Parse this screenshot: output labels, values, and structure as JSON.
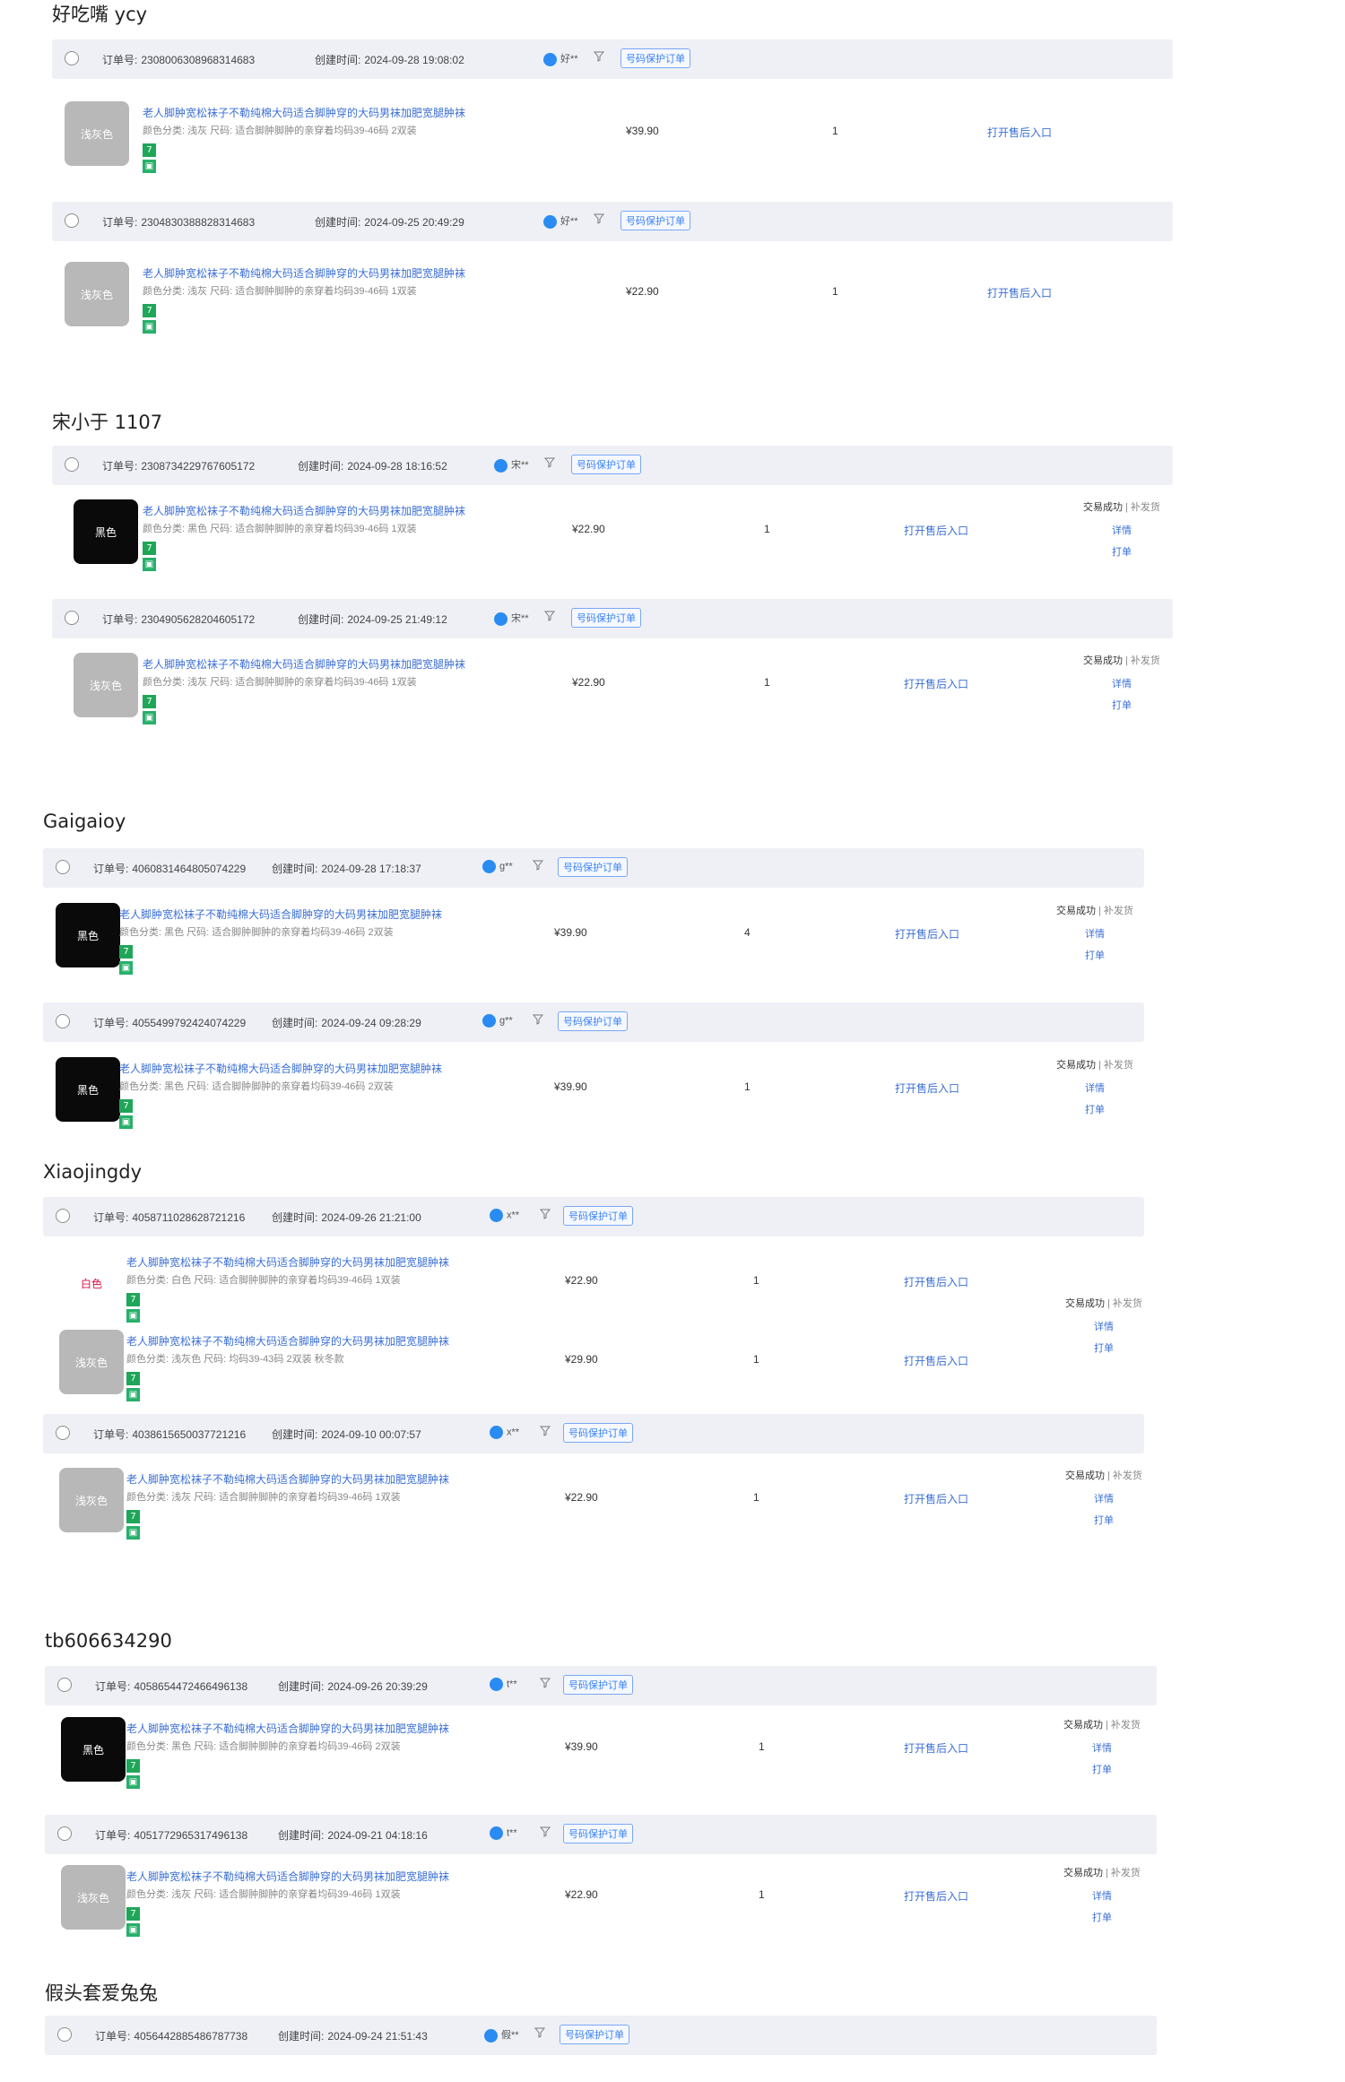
{
  "labels": {
    "order_no": "订单号:",
    "created": "创建时间:",
    "protect_tag": "号码保护订单",
    "after_sale": "打开售后入口",
    "status_ok": "交易成功",
    "detail": "详情",
    "print": "打单",
    "extra_sep": "| 补发货"
  },
  "product_title": "老人脚肿宽松袜子不勒纯棉大码适合脚肿穿的大码男袜加肥宽腿肿袜",
  "sections": [
    {
      "shop": "好吃嘴 ycy",
      "orders": [
        {
          "order_no": "2308006308968314683",
          "created": "2024-09-28 19:08:02",
          "buyer": "好**",
          "items": [
            {
              "thumb": "浅灰色",
              "spec": "颜色分类: 浅灰  尺码: 适合脚肿脚肿的亲穿着均码39-46码 2双装",
              "price": "¥39.90",
              "qty": "1"
            }
          ]
        },
        {
          "order_no": "2304830388828314683",
          "created": "2024-09-25 20:49:29",
          "buyer": "好**",
          "items": [
            {
              "thumb": "浅灰色",
              "spec": "颜色分类: 浅灰  尺码: 适合脚肿脚肿的亲穿着均码39-46码 1双装",
              "price": "¥22.90",
              "qty": "1"
            }
          ]
        }
      ]
    },
    {
      "shop": "宋小于 1107",
      "orders": [
        {
          "order_no": "2308734229767605172",
          "created": "2024-09-28 18:16:52",
          "buyer": "宋**",
          "items": [
            {
              "thumb": "黑色",
              "spec": "颜色分类: 黑色  尺码: 适合脚肿脚肿的亲穿着均码39-46码 1双装",
              "price": "¥22.90",
              "qty": "1"
            }
          ]
        },
        {
          "order_no": "2304905628204605172",
          "created": "2024-09-25 21:49:12",
          "buyer": "宋**",
          "items": [
            {
              "thumb": "浅灰色",
              "spec": "颜色分类: 浅灰  尺码: 适合脚肿脚肿的亲穿着均码39-46码 1双装",
              "price": "¥22.90",
              "qty": "1"
            }
          ]
        }
      ]
    },
    {
      "shop": "Gaigaioy",
      "orders": [
        {
          "order_no": "4060831464805074229",
          "created": "2024-09-28 17:18:37",
          "buyer": "g**",
          "items": [
            {
              "thumb": "黑色",
              "spec": "颜色分类: 黑色  尺码: 适合脚肿脚肿的亲穿着均码39-46码 2双装",
              "price": "¥39.90",
              "qty": "4"
            }
          ]
        },
        {
          "order_no": "4055499792424074229",
          "created": "2024-09-24 09:28:29",
          "buyer": "g**",
          "items": [
            {
              "thumb": "黑色",
              "spec": "颜色分类: 黑色  尺码: 适合脚肿脚肿的亲穿着均码39-46码 2双装",
              "price": "¥39.90",
              "qty": "1"
            }
          ]
        }
      ]
    },
    {
      "shop": "Xiaojingdy",
      "orders": [
        {
          "order_no": "4058711028628721216",
          "created": "2024-09-26 21:21:00",
          "buyer": "x**",
          "items": [
            {
              "thumb": "白色",
              "spec": "颜色分类: 白色  尺码: 适合脚肿脚肿的亲穿着均码39-46码 1双装",
              "price": "¥22.90",
              "qty": "1"
            },
            {
              "thumb": "浅灰色",
              "spec": "颜色分类: 浅灰色  尺码: 均码39-43码 2双装 秋冬款",
              "price": "¥29.90",
              "qty": "1"
            }
          ]
        },
        {
          "order_no": "4038615650037721216",
          "created": "2024-09-10 00:07:57",
          "buyer": "x**",
          "items": [
            {
              "thumb": "浅灰色",
              "spec": "颜色分类: 浅灰  尺码: 适合脚肿脚肿的亲穿着均码39-46码 1双装",
              "price": "¥22.90",
              "qty": "1"
            }
          ]
        }
      ]
    },
    {
      "shop": "tb606634290",
      "orders": [
        {
          "order_no": "4058654472466496138",
          "created": "2024-09-26 20:39:29",
          "buyer": "t**",
          "items": [
            {
              "thumb": "黑色",
              "spec": "颜色分类: 黑色  尺码: 适合脚肿脚肿的亲穿着均码39-46码 2双装",
              "price": "¥39.90",
              "qty": "1"
            }
          ]
        },
        {
          "order_no": "4051772965317496138",
          "created": "2024-09-21 04:18:16",
          "buyer": "t**",
          "items": [
            {
              "thumb": "浅灰色",
              "spec": "颜色分类: 浅灰  尺码: 适合脚肿脚肿的亲穿着均码39-46码 1双装",
              "price": "¥22.90",
              "qty": "1"
            }
          ]
        }
      ]
    },
    {
      "shop": "假头套爱兔兔",
      "orders": [
        {
          "order_no": "4056442885486787738",
          "created": "2024-09-24 21:51:43",
          "buyer": "假**",
          "items": []
        }
      ]
    }
  ],
  "colors": {
    "header_bg": "#eef0f6",
    "link": "#3b6fd4",
    "badge_green": "#1fa659",
    "ww_blue": "#2a8bf2"
  },
  "icons": {
    "buyer": "wangwang-icon",
    "filter": "filter-icon",
    "badge7": "seven-day-return-icon",
    "badgeShop": "shop-badge-icon"
  }
}
